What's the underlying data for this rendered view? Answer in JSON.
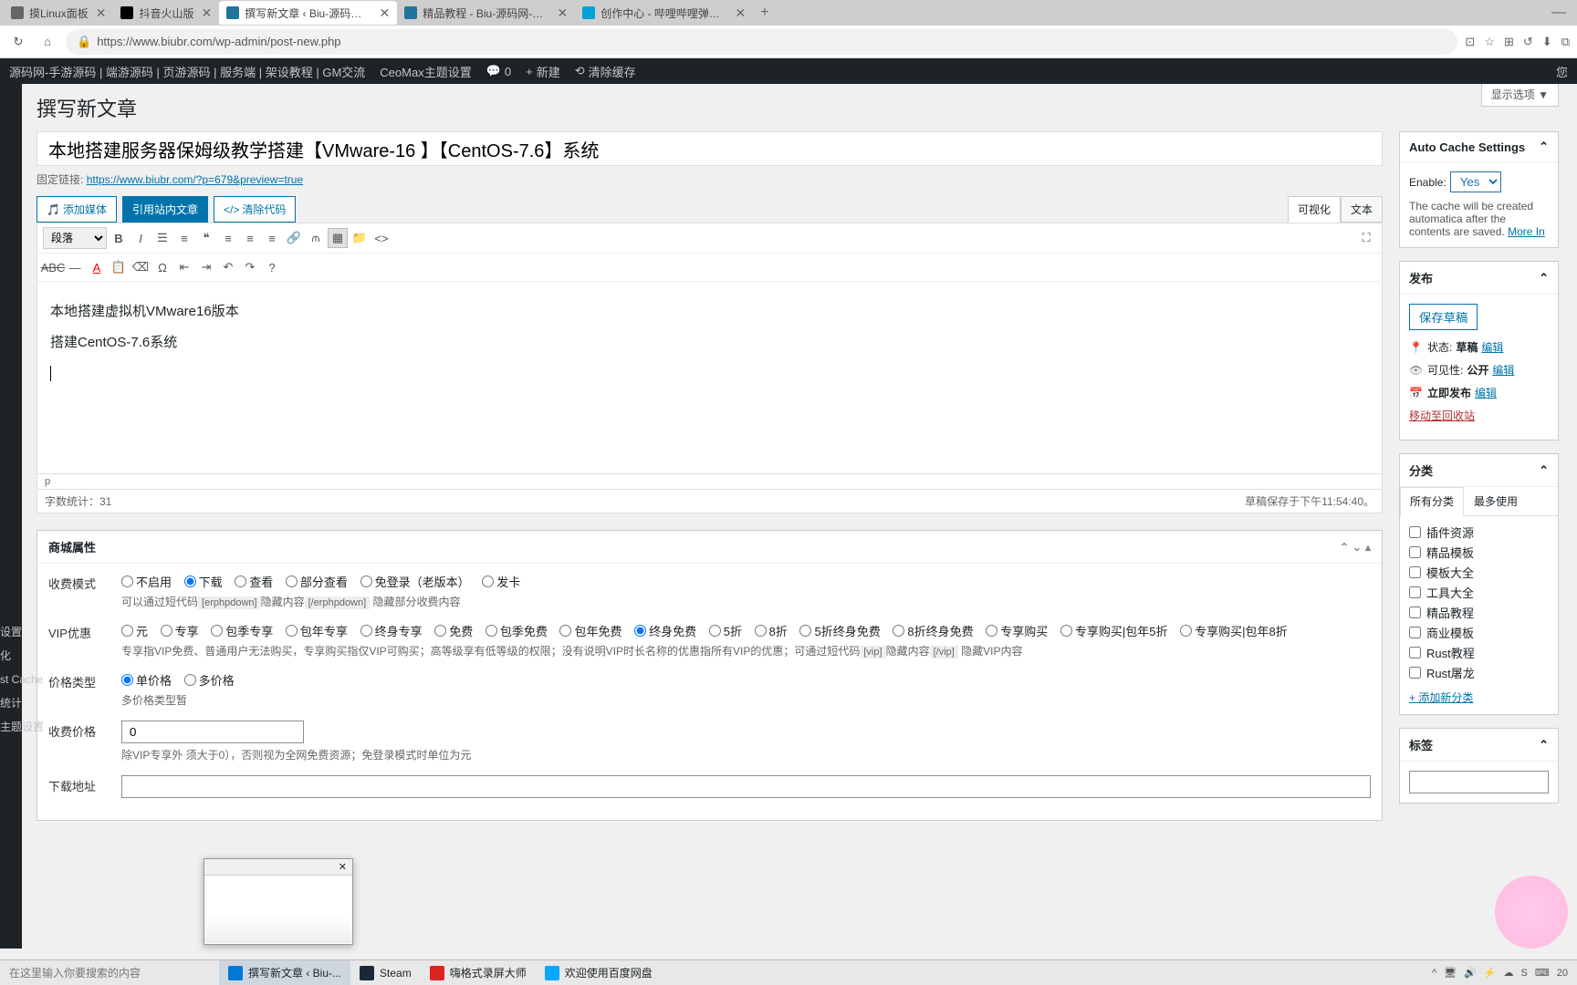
{
  "browser": {
    "tabs": [
      {
        "title": "摸Linux面板"
      },
      {
        "title": "抖音火山版"
      },
      {
        "title": "撰写新文章 ‹ Biu-源码网-手游源",
        "active": true
      },
      {
        "title": "精品教程 - Biu-源码网-手游源码"
      },
      {
        "title": "创作中心 - 哔哩哔哩弹幕视频网"
      }
    ],
    "url": "https://www.biubr.com/wp-admin/post-new.php"
  },
  "wp_toolbar": {
    "site": "源码网-手游源码 | 端游源码 | 页游源码 | 服务端 | 架设教程 | GM交流",
    "theme": "CeoMax主题设置",
    "comments": "0",
    "new": "新建",
    "cache": "清除缓存",
    "right": "您"
  },
  "sidebar_labels": [
    "设置",
    "化",
    "st Cache",
    "统计",
    "主题设置"
  ],
  "screen_options": "显示选项 ▼",
  "page_title": "撰写新文章",
  "post": {
    "title": "本地搭建服务器保姆级教学搭建【VMware-16 】【CentOS-7.6】系统",
    "permalink_label": "固定链接:",
    "permalink_url": "https://www.biubr.com/?p=679&preview=true",
    "add_media": "添加媒体",
    "insert_post": "引用站内文章",
    "clear_code": "清除代码",
    "tab_visual": "可视化",
    "tab_text": "文本",
    "format_select": "段落",
    "content_p1": "本地搭建虚拟机VMware16版本",
    "content_p2": "搭建CentOS-7.6系统",
    "status_p": "p",
    "word_count": "字数统计：31",
    "draft_saved": "草稿保存于下午11:54:40。"
  },
  "mall": {
    "title": "商城属性",
    "fee_mode_label": "收费模式",
    "fee_options": [
      "不启用",
      "下载",
      "查看",
      "部分查看",
      "免登录（老版本）",
      "发卡"
    ],
    "fee_desc_pre": "可以通过短代码",
    "fee_code1": "[erphpdown]",
    "fee_desc_mid": "隐藏内容",
    "fee_code2": "[/erphpdown]",
    "fee_desc_post": " 隐藏部分收费内容",
    "vip_label": "VIP优惠",
    "vip_options": [
      "元",
      "专享",
      "包季专享",
      "包年专享",
      "终身专享",
      "免费",
      "包季免费",
      "包年免费",
      "终身免费",
      "5折",
      "8折",
      "5折终身免费",
      "8折终身免费",
      "专享购买",
      "专享购买|包年5折",
      "专享购买|包年8折"
    ],
    "vip_desc_pre": "专享指VIP免费、普通用户无法购买，专享购买指仅VIP可购买；高等级享有低等级的权限；没有说明VIP时长名称的优惠指所有VIP的优惠；可通过短代码",
    "vip_code1": "[vip]",
    "vip_desc_mid": "隐藏内容",
    "vip_code2": "[/vip]",
    "vip_desc_post": " 隐藏VIP内容",
    "price_type_label": "价格类型",
    "price_types": [
      "单价格",
      "多价格"
    ],
    "price_type_desc": "多价格类型暂",
    "price_label": "收费价格",
    "price_value": "0",
    "price_desc": "除VIP专享外                                                              须大于0），否则视为全网免费资源；免登录模式时单位为元",
    "download_label": "下载地址"
  },
  "cache": {
    "title": "Auto Cache Settings",
    "enable_label": "Enable:",
    "enable_value": "Yes",
    "desc": "The cache will be created automatica after the contents are saved.",
    "more": "More In"
  },
  "publish": {
    "title": "发布",
    "save_draft": "保存草稿",
    "status_label": "状态:",
    "status_value": "草稿",
    "visibility_label": "可见性:",
    "visibility_value": "公开",
    "publish_label": "立即发布",
    "edit": "编辑",
    "trash": "移动至回收站"
  },
  "categories": {
    "title": "分类",
    "tab_all": "所有分类",
    "tab_used": "最多使用",
    "items": [
      "插件资源",
      "精品模板",
      "模板大全",
      "工具大全",
      "精品教程",
      "商业模板",
      "Rust教程",
      "Rust屠龙"
    ],
    "add_new": "+ 添加新分类"
  },
  "tags": {
    "title": "标签"
  },
  "taskbar": {
    "search_placeholder": "在这里输入你要搜索的内容",
    "items": [
      {
        "label": "撰写新文章 ‹ Biu-...",
        "color": "#0078d7",
        "active": true
      },
      {
        "label": "Steam",
        "color": "#1b2838"
      },
      {
        "label": "嗨格式录屏大师",
        "color": "#d22"
      },
      {
        "label": "欢迎使用百度网盘",
        "color": "#06a7ff"
      }
    ],
    "time": "20"
  },
  "preview_popup": {
    "title": "",
    "close": "✕"
  }
}
